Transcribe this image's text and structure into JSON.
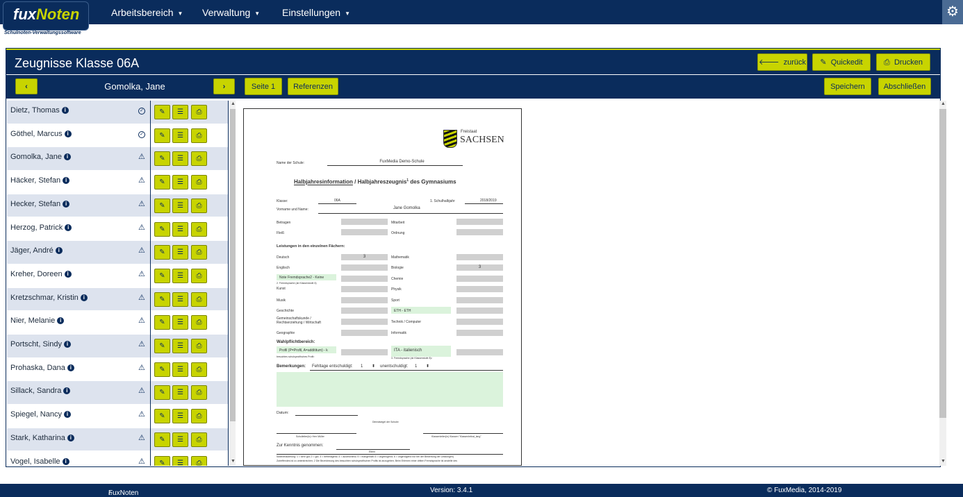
{
  "app": {
    "logo_main": "fux",
    "logo_accent": "Noten",
    "logo_sub": "Schulnoten-Verwaltungssoftware",
    "nav": [
      "Arbeitsbereich",
      "Verwaltung",
      "Einstellungen"
    ]
  },
  "header": {
    "title": "Zeugnisse Klasse 06A",
    "back_label": "zurück",
    "quickedit_label": "Quickedit",
    "print_label": "Drucken"
  },
  "subheader": {
    "current_student": "Gomolka, Jane",
    "page_label": "Seite 1",
    "references_label": "Referenzen",
    "save_label": "Speichern",
    "finish_label": "Abschließen"
  },
  "students": [
    {
      "name": "Dietz, Thomas",
      "status": "done"
    },
    {
      "name": "Göthel, Marcus",
      "status": "done"
    },
    {
      "name": "Gomolka, Jane",
      "status": "warning"
    },
    {
      "name": "Häcker, Stefan",
      "status": "warning"
    },
    {
      "name": "Hecker, Stefan",
      "status": "warning"
    },
    {
      "name": "Herzog, Patrick",
      "status": "warning"
    },
    {
      "name": "Jäger, André",
      "status": "warning"
    },
    {
      "name": "Kreher, Doreen",
      "status": "warning"
    },
    {
      "name": "Kretzschmar, Kristin",
      "status": "warning"
    },
    {
      "name": "Nier, Melanie",
      "status": "warning"
    },
    {
      "name": "Portscht, Sindy",
      "status": "warning"
    },
    {
      "name": "Prohaska, Dana",
      "status": "warning"
    },
    {
      "name": "Sillack, Sandra",
      "status": "warning"
    },
    {
      "name": "Spiegel, Nancy",
      "status": "warning"
    },
    {
      "name": "Stark, Katharina",
      "status": "warning"
    },
    {
      "name": "Vogel, Isabelle",
      "status": "warning"
    }
  ],
  "document": {
    "state_small": "Freistaat",
    "state_big": "SACHSEN",
    "school_label": "Name der Schule:",
    "school_value": "FuxMedia Demo-Schule",
    "heading_u": "Halbjahresinformation",
    "heading_rest": " / Halbjahreszeugnis",
    "heading_sup": "1",
    "heading_end": " des Gymnasiums",
    "class_label": "Klasse:",
    "class_value": "06A",
    "half_label": "1. Schulhalbjahr",
    "year_value": "2018/2019",
    "name_label": "Vorname und Name:",
    "name_value": "Jane Gomolka",
    "betragen": "Betragen",
    "mitarbeit": "Mitarbeit",
    "fleiss": "Fleiß",
    "ordnung": "Ordnung",
    "leistungen": "Leistungen in den einzelnen Fächern:",
    "deutsch": "Deutsch",
    "deutsch_grade": "3",
    "mathematik": "Mathematik",
    "englisch": "Englisch",
    "biologie": "Biologie",
    "biologie_grade": "3",
    "fremdsprache_value": "Note Fremdsprache2 - Keine",
    "fremdsprache_label": "2. Fremdsprache (ab Klassenstufe 6)",
    "chemie": "Chemie",
    "kunst": "Kunst",
    "physik": "Physik",
    "musik": "Musik",
    "sport": "Sport",
    "geschichte": "Geschichte",
    "eth_value": "ETH - ETH",
    "gemeinschaft": "Gemeinschaftskunde / Rechtserziehung / Wirtschaft",
    "technik": "Technik / Computer",
    "geographie": "Geographie",
    "informatik": "Informatik",
    "wahlpflicht": "Wahlpflichtbereich:",
    "profil_value": "Profil (P=Profil, A=addititum) - k",
    "profil_label": "besuchtes schulspezifisches Profil²",
    "ita_value": "ITA - italienisch",
    "fremd3_label": "3. Fremdsprache (ab Klassenstufe 8)²",
    "bemerkungen": "Bemerkungen:",
    "fehltage_e": "Fehltage entschuldigt:",
    "fehltage_e_val": "1",
    "fehltage_u": "unentschuldigt:",
    "fehltage_u_val": "1",
    "datum": "Datum:",
    "dienstsiegel": "Dienstsiegel der Schule²",
    "schulleiter": "Schulleiter(in)² Herr Müller",
    "klassenleiter": "Klassenleiter(in) Klassen \"Klassenleitrat_lang\"",
    "kenntnis": "Zur Kenntnis genommen:",
    "eltern": "Eltern",
    "foot1": "Notenerläuterung: 1 = sehr gut; 2 = gut; 3 = befriedigend; 4 = ausreichend; 5 = mangelhaft; 6 = ungenügend; 6 = ungenügend nur bei der Bewertung der Leistungen)",
    "foot2": "Zutreffendes ist zu unterstreichen; 2 Die Bezeichnung des besuchten schulspezifischen Profils ist anzugeben; Beim Erlernen einer dritten Fremdsprache ist anstelle des"
  },
  "footer": {
    "home": "FuxNoten",
    "version": "Version: 3.4.1",
    "copyright": "© FuxMedia, 2014-2019"
  }
}
